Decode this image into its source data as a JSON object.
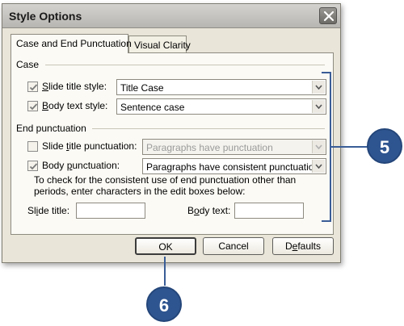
{
  "dialog": {
    "title": "Style Options",
    "close_label": "×"
  },
  "tabs": [
    {
      "label": "Case and End Punctuation",
      "active": true
    },
    {
      "label": "Visual Clarity",
      "active": false
    }
  ],
  "case": {
    "heading": "Case",
    "slide_title": {
      "prefix": "",
      "hotkey": "S",
      "rest": "lide title style:",
      "checked": true,
      "value": "Title Case"
    },
    "body_text": {
      "prefix": "",
      "hotkey": "B",
      "rest": "ody text style:",
      "checked": true,
      "value": "Sentence case"
    }
  },
  "end_punctuation": {
    "heading": "End punctuation",
    "slide_title": {
      "prefix": "Slide ",
      "hotkey": "t",
      "rest": "itle punctuation:",
      "checked": false,
      "value": "Paragraphs have punctuation",
      "disabled": true
    },
    "body": {
      "prefix": "Body ",
      "hotkey": "p",
      "rest": "unctuation:",
      "checked": true,
      "value": "Paragraphs have consistent punctuation"
    }
  },
  "help_text": "To check for the consistent use of end punctuation other than periods, enter characters in the edit boxes below:",
  "edit_boxes": {
    "slide_title": {
      "prefix": "Sl",
      "hotkey": "i",
      "rest": "de title:",
      "value": ""
    },
    "body_text": {
      "prefix": "B",
      "hotkey": "o",
      "rest": "dy text:",
      "value": ""
    }
  },
  "buttons": {
    "ok": "OK",
    "cancel": "Cancel",
    "defaults_prefix": "D",
    "defaults_hotkey": "e",
    "defaults_rest": "faults"
  },
  "callouts": [
    {
      "number": "5"
    },
    {
      "number": "6"
    }
  ],
  "colors": {
    "callout": "#2f5590",
    "callout_line": "#3a5d97",
    "dialog_bg": "#e9e5d8"
  }
}
